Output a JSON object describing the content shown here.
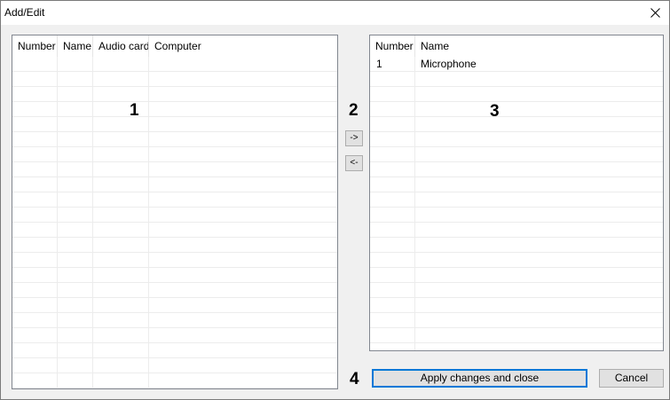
{
  "window": {
    "title": "Add/Edit",
    "close_icon": "close-icon"
  },
  "left_list": {
    "columns": [
      "Number",
      "Name",
      "Audio card",
      "Computer"
    ],
    "rows": []
  },
  "right_list": {
    "columns": [
      "Number",
      "Name"
    ],
    "rows": [
      {
        "number": "1",
        "name": "Microphone"
      }
    ]
  },
  "transfer": {
    "add_label": "->",
    "remove_label": "<-"
  },
  "annotations": {
    "a1": "1",
    "a2": "2",
    "a3": "3",
    "a4": "4"
  },
  "buttons": {
    "apply_label": "Apply changes and close",
    "cancel_label": "Cancel"
  },
  "colors": {
    "focus_border": "#0078d7",
    "window_bg": "#f0f0f0"
  }
}
